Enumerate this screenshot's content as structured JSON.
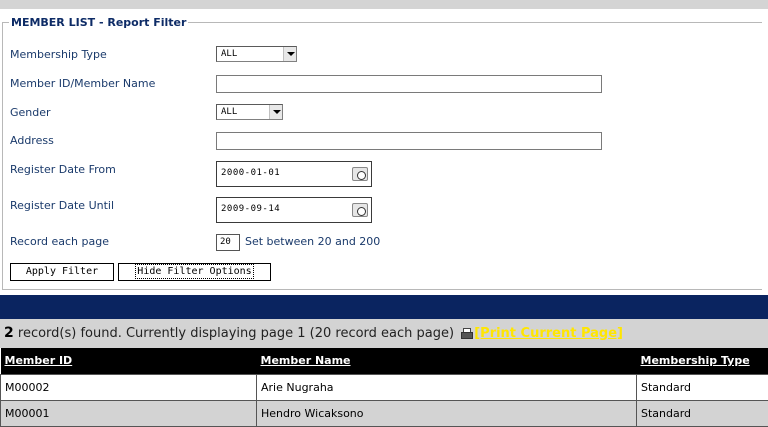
{
  "filter": {
    "legend": "MEMBER LIST - Report Filter",
    "membership_type": {
      "label": "Membership Type",
      "value": "ALL"
    },
    "member_id_name": {
      "label": "Member ID/Member Name",
      "value": ""
    },
    "gender": {
      "label": "Gender",
      "value": "ALL"
    },
    "address": {
      "label": "Address",
      "value": ""
    },
    "register_from": {
      "label": "Register Date From",
      "value": "2000-01-01"
    },
    "register_until": {
      "label": "Register Date Until",
      "value": "2009-09-14"
    },
    "record_each_page": {
      "label": "Record each page",
      "value": "20",
      "hint": "Set between 20 and 200"
    },
    "apply_label": "Apply Filter",
    "hide_label": "Hide Filter Options"
  },
  "summary": {
    "count": "2",
    "text": " record(s) found. Currently displaying page 1 (20 record each page) ",
    "print_label": "[Print Current Page]",
    "print_icon": "printer-icon"
  },
  "table": {
    "headers": [
      "Member ID",
      "Member Name",
      "Membership Type"
    ],
    "rows": [
      [
        "M00002",
        "Arie Nugraha",
        "Standard"
      ],
      [
        "M00001",
        "Hendro Wicaksono",
        "Standard"
      ]
    ]
  },
  "colors": {
    "nav_bar": "#0a2460",
    "print_link": "#ffe600",
    "header_row": "#000000"
  }
}
